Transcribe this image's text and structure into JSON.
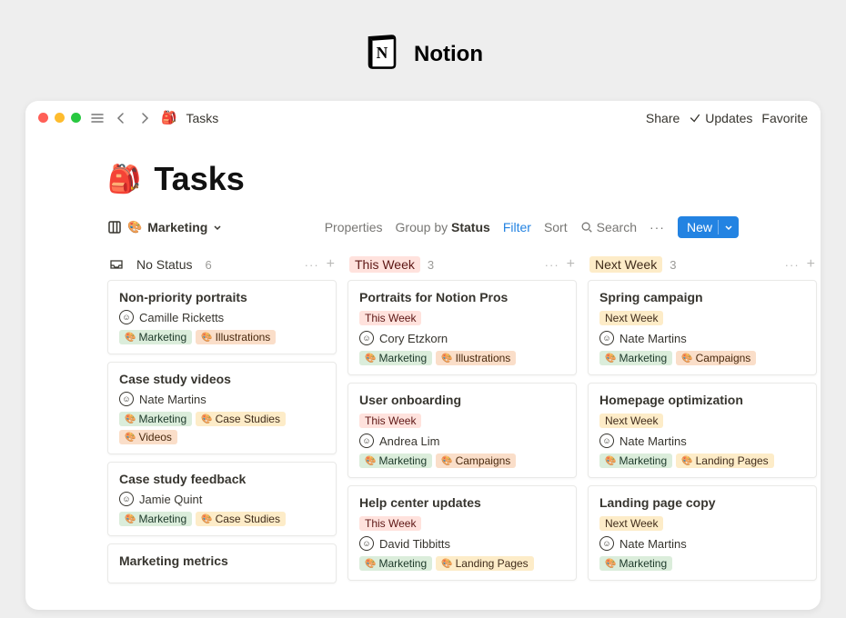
{
  "branding": {
    "name": "Notion"
  },
  "titlebar": {
    "breadcrumb": "Tasks",
    "share": "Share",
    "updates": "Updates",
    "favorite": "Favorite"
  },
  "page": {
    "title": "Tasks"
  },
  "toolbar": {
    "view_name": "Marketing",
    "properties": "Properties",
    "groupby_prefix": "Group by ",
    "groupby_value": "Status",
    "filter": "Filter",
    "sort": "Sort",
    "search": "Search",
    "new": "New"
  },
  "columns": [
    {
      "key": "nostatus",
      "name": "No Status",
      "count": "6",
      "status_label": "",
      "cards": [
        {
          "title": "Non-priority portraits",
          "assignee": "Camille Ricketts",
          "tags": [
            {
              "label": "Marketing",
              "cls": "marketing"
            },
            {
              "label": "Illustrations",
              "cls": "illustrations"
            }
          ]
        },
        {
          "title": "Case study videos",
          "assignee": "Nate Martins",
          "tags": [
            {
              "label": "Marketing",
              "cls": "marketing"
            },
            {
              "label": "Case Studies",
              "cls": "casestudies"
            },
            {
              "label": "Videos",
              "cls": "videos"
            }
          ]
        },
        {
          "title": "Case study feedback",
          "assignee": "Jamie Quint",
          "tags": [
            {
              "label": "Marketing",
              "cls": "marketing"
            },
            {
              "label": "Case Studies",
              "cls": "casestudies"
            }
          ]
        },
        {
          "title": "Marketing metrics",
          "assignee": "",
          "tags": []
        }
      ]
    },
    {
      "key": "thisweek",
      "name": "This Week",
      "count": "3",
      "status_label": "This Week",
      "cards": [
        {
          "title": "Portraits for Notion Pros",
          "assignee": "Cory Etzkorn",
          "tags": [
            {
              "label": "Marketing",
              "cls": "marketing"
            },
            {
              "label": "Illustrations",
              "cls": "illustrations"
            }
          ]
        },
        {
          "title": "User onboarding",
          "assignee": "Andrea Lim",
          "tags": [
            {
              "label": "Marketing",
              "cls": "marketing"
            },
            {
              "label": "Campaigns",
              "cls": "campaigns"
            }
          ]
        },
        {
          "title": "Help center updates",
          "assignee": "David Tibbitts",
          "tags": [
            {
              "label": "Marketing",
              "cls": "marketing"
            },
            {
              "label": "Landing Pages",
              "cls": "landingpages"
            }
          ]
        }
      ]
    },
    {
      "key": "nextweek",
      "name": "Next Week",
      "count": "3",
      "status_label": "Next Week",
      "cards": [
        {
          "title": "Spring campaign",
          "assignee": "Nate Martins",
          "tags": [
            {
              "label": "Marketing",
              "cls": "marketing"
            },
            {
              "label": "Campaigns",
              "cls": "campaigns"
            }
          ]
        },
        {
          "title": "Homepage optimization",
          "assignee": "Nate Martins",
          "tags": [
            {
              "label": "Marketing",
              "cls": "marketing"
            },
            {
              "label": "Landing Pages",
              "cls": "landingpages"
            }
          ]
        },
        {
          "title": "Landing page copy",
          "assignee": "Nate Martins",
          "tags": [
            {
              "label": "Marketing",
              "cls": "marketing"
            }
          ]
        }
      ]
    }
  ]
}
